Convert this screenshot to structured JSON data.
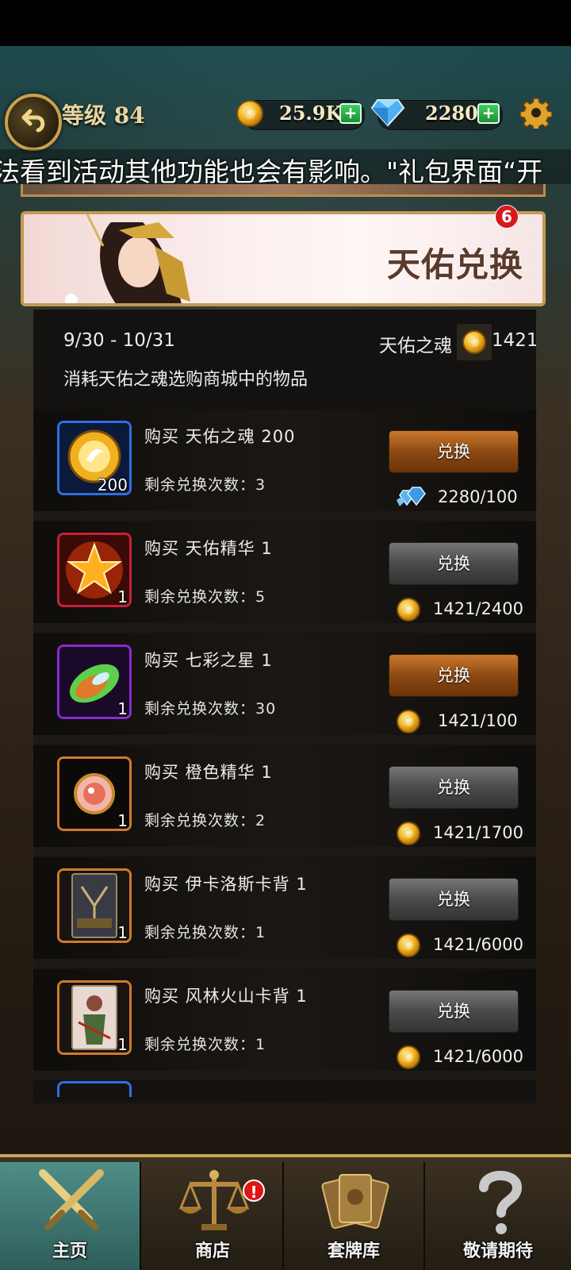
{
  "header": {
    "level_label": "等级 84",
    "gold_value": "25.9K",
    "gem_value": "2280",
    "plus_label": "+"
  },
  "marquee": {
    "text": "法看到活动其他功能也会有影响。\"礼包界面“开"
  },
  "banner": {
    "title": "天佑兑换",
    "badge_count": "6"
  },
  "info": {
    "period": "9/30 - 10/31",
    "currency_label": "天佑之魂",
    "currency_amount": "1421",
    "description": "消耗天佑之魂选购商城中的物品"
  },
  "exchange_label": "兑换",
  "items": [
    {
      "title": "购买 天佑之魂 200",
      "count": "200",
      "remain": "剩余兑换次数：3",
      "cost": "2280/100",
      "cost_icon": "gem-icon",
      "state": "active",
      "frame_color": "#2f6fe0"
    },
    {
      "title": "购买 天佑精华 1",
      "count": "1",
      "remain": "剩余兑换次数：5",
      "cost": "1421/2400",
      "cost_icon": "coin-icon",
      "state": "inactive",
      "frame_color": "#c8203a"
    },
    {
      "title": "购买 七彩之星  1",
      "count": "1",
      "remain": "剩余兑换次数：30",
      "cost": "1421/100",
      "cost_icon": "coin-icon",
      "state": "active",
      "frame_color": "#8a2ad0"
    },
    {
      "title": "购买 橙色精华  1",
      "count": "1",
      "remain": "剩余兑换次数：2",
      "cost": "1421/1700",
      "cost_icon": "coin-icon",
      "state": "inactive",
      "frame_color": "#d07a2a"
    },
    {
      "title": "购买 伊卡洛斯卡背 1",
      "count": "1",
      "remain": "剩余兑换次数：1",
      "cost": "1421/6000",
      "cost_icon": "coin-icon",
      "state": "inactive",
      "frame_color": "#d07a2a"
    },
    {
      "title": "购买 风林火山卡背 1",
      "count": "1",
      "remain": "剩余兑换次数：1",
      "cost": "1421/6000",
      "cost_icon": "coin-icon",
      "state": "inactive",
      "frame_color": "#d07a2a"
    }
  ],
  "nav": {
    "home": "主页",
    "shop": "商店",
    "deck": "套牌库",
    "coming": "敬请期待",
    "shop_alert": "!"
  }
}
